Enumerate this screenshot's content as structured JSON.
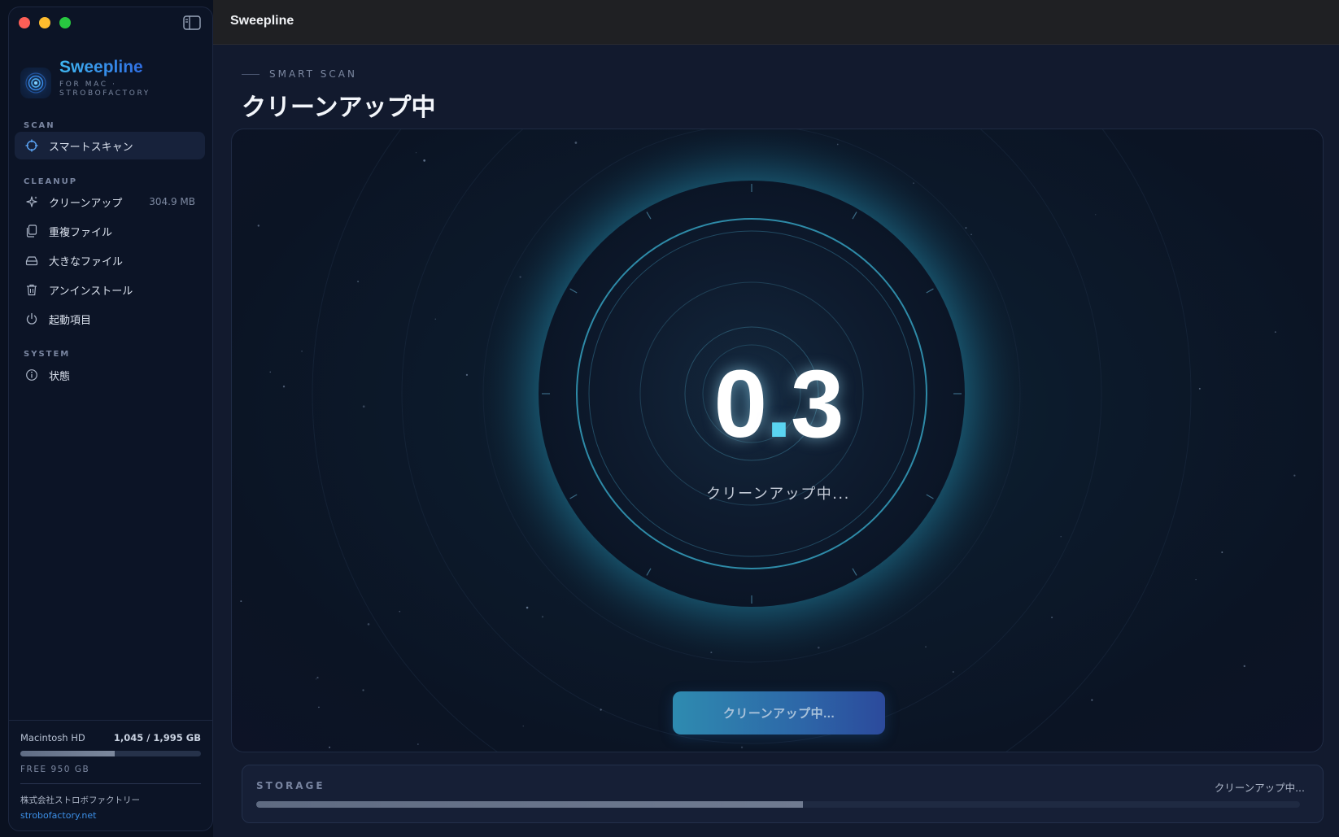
{
  "app": {
    "window_title": "Sweepline",
    "brand_name": "Sweepline",
    "brand_sub_line1": "FOR MAC ·",
    "brand_sub_line2": "STROBOFACTORY"
  },
  "sidebar": {
    "sections": [
      {
        "label": "SCAN"
      },
      {
        "label": "CLEANUP"
      },
      {
        "label": "SYSTEM"
      }
    ],
    "items": [
      {
        "label": "スマートスキャン",
        "icon": "crosshair-icon",
        "active": true,
        "meta": ""
      },
      {
        "label": "クリーンアップ",
        "icon": "sparkle-icon",
        "active": false,
        "meta": "304.9 MB"
      },
      {
        "label": "重複ファイル",
        "icon": "duplicate-files-icon",
        "active": false,
        "meta": ""
      },
      {
        "label": "大きなファイル",
        "icon": "drive-icon",
        "active": false,
        "meta": ""
      },
      {
        "label": "アンインストール",
        "icon": "trash-icon",
        "active": false,
        "meta": ""
      },
      {
        "label": "起動項目",
        "icon": "power-icon",
        "active": false,
        "meta": ""
      },
      {
        "label": "状態",
        "icon": "info-icon",
        "active": false,
        "meta": ""
      }
    ],
    "disk": {
      "name": "Macintosh HD",
      "usage": "1,045 / 1,995 GB",
      "used_fraction": 0.524,
      "free": "FREE 950 GB"
    },
    "company": "株式会社ストロボファクトリー",
    "company_link": "strobofactory.net"
  },
  "main": {
    "eyebrow": "SMART SCAN",
    "title": "クリーンアップ中",
    "counter_whole": "0",
    "counter_frac": "3",
    "status": "クリーンアップ中...",
    "button_label": "クリーンアップ中..."
  },
  "storage": {
    "label": "STORAGE",
    "status": "クリーンアップ中...",
    "progress_fraction": 0.524
  },
  "colors": {
    "accent_cyan": "#5ad5f2",
    "accent_blue": "#2e68e3",
    "close": "#fe5f57",
    "minimize": "#febc2e",
    "maximize": "#28c840"
  }
}
